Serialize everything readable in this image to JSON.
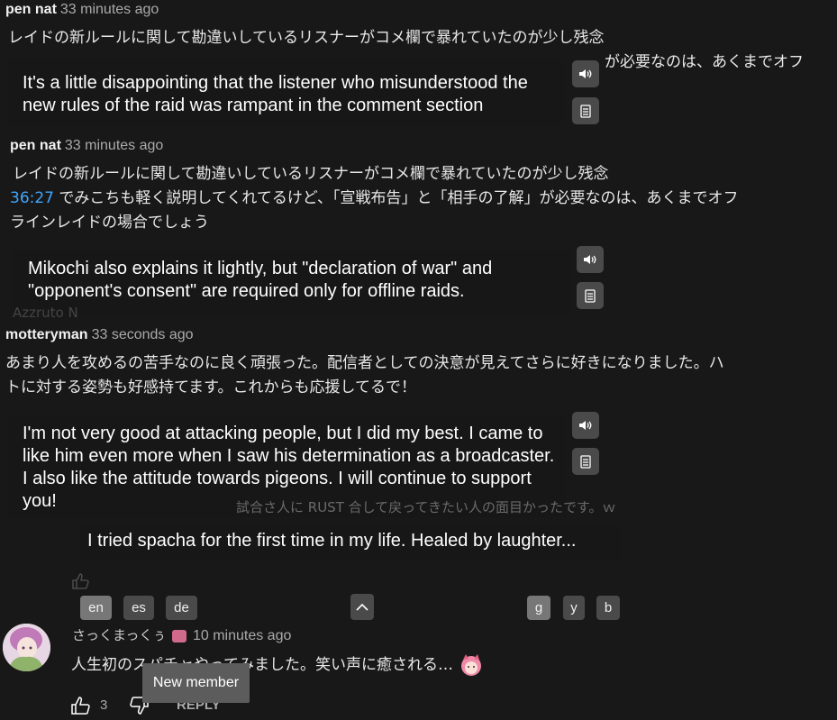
{
  "comments": [
    {
      "author": "pen nat",
      "time": "33 minutes ago",
      "line1": "レイドの新ルールに関して勘違いしているリスナーがコメ欄で暴れていたのが少し残念",
      "line2_tail": "が必要なのは、あくまでオフ",
      "translation": "It's a little disappointing that the listener who misunderstood the new rules of the raid was rampant in the comment section"
    },
    {
      "author": "pen nat",
      "time": "33 minutes ago",
      "line1": "レイドの新ルールに関して勘違いしているリスナーがコメ欄で暴れていたのが少し残念",
      "timestamp": "36:27",
      "line2": " でみこちも軽く説明してくれてるけど、「宣戦布告」と「相手の了解」が必要なのは、あくまでオフ",
      "line3": "ラインレイドの場合でしょう",
      "translation": "Mikochi also explains it lightly, but \"declaration of war\" and \"opponent's consent\" are required only for offline raids."
    },
    {
      "author": "motteryman",
      "time": "33 seconds ago",
      "line1": "あまり人を攻めるの苦手なのに良く頑張った。配信者としての決意が見えてさらに好きになりました。ハ",
      "line2": "トに対する姿勢も好感持てます。これからも応援してるで！",
      "translation": "I'm not very good at attacking people, but I did my best. I came to like him even more when I saw his determination as a broadcaster. I also like the attitude towards pigeons. I will continue to support you!"
    }
  ],
  "ghost": {
    "author3": "Azzruto N",
    "line_mid": "試合さ人に RUST 合して戻ってきたい人の面目かったです。ｗ"
  },
  "floating_translation": "I tried spacha for the first time in my life. Healed by laughter...",
  "lang_buttons": [
    "en",
    "es",
    "de"
  ],
  "engine_buttons": [
    "g",
    "y",
    "b"
  ],
  "bottom_comment": {
    "author": "さっくまっくぅ",
    "time": "10 minutes ago",
    "text": "人生初のスパチャやってみました。笑い声に癒される…",
    "likes": "3",
    "reply": "REPLY",
    "tooltip": "New member"
  },
  "colors": {
    "background": "#181818",
    "timestamp_link": "#3ea6ff",
    "button_bg": "#4a4a4a",
    "button_active": "#777777"
  }
}
